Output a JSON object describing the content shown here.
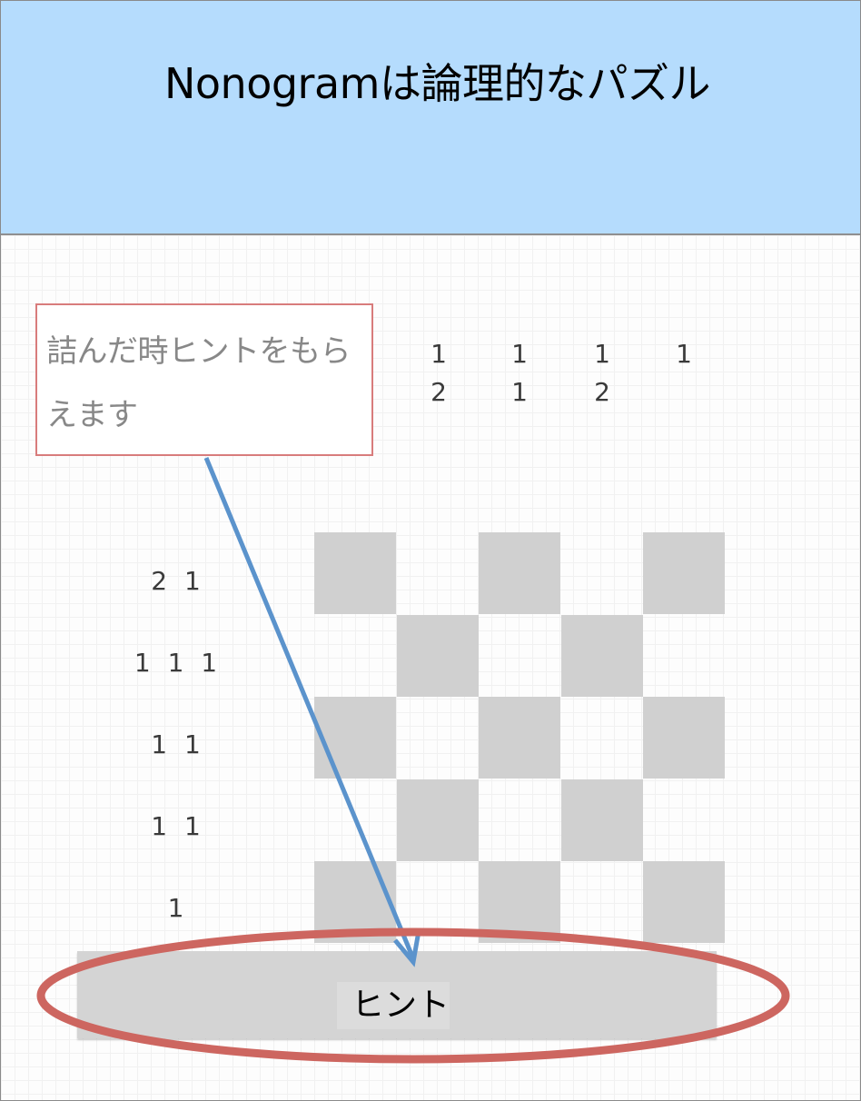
{
  "header": {
    "title": "Nonogramは論理的なパズル"
  },
  "callout": {
    "text": "詰んだ時ヒントをもらえます"
  },
  "puzzle": {
    "column_clues": [
      [
        "1",
        "2"
      ],
      [
        "1",
        "1"
      ],
      [
        "1",
        "2"
      ],
      [
        "1"
      ]
    ],
    "row_clues": [
      "2 1",
      "1 1 1",
      "1 1",
      "1 1",
      "1"
    ],
    "grid": [
      [
        1,
        0,
        1,
        0,
        1
      ],
      [
        0,
        1,
        0,
        1,
        0
      ],
      [
        1,
        0,
        1,
        0,
        1
      ],
      [
        0,
        1,
        0,
        1,
        0
      ],
      [
        1,
        0,
        1,
        0,
        1
      ]
    ]
  },
  "hint_button": {
    "label": "ヒント"
  },
  "colors": {
    "header_bg": "#b5dcfd",
    "cell_filled": "#d0d0d0",
    "annotation_red": "#cd6660",
    "annotation_arrow": "#5b93cc"
  }
}
